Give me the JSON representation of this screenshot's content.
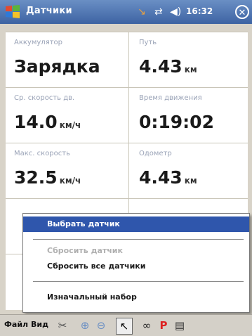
{
  "titlebar": {
    "title": "Датчики",
    "time": "16:32",
    "icons": [
      "start-menu-icon",
      "gps-signal-icon",
      "connectivity-icon",
      "volume-icon",
      "close-icon"
    ]
  },
  "sensors": [
    {
      "label": "Аккумулятор",
      "value": "Зарядка",
      "unit": ""
    },
    {
      "label": "Путь",
      "value": "4.43",
      "unit": "км"
    },
    {
      "label": "Ср. скорость дв.",
      "value": "14.0",
      "unit": "км/ч"
    },
    {
      "label": "Время движения",
      "value": "0:19:02",
      "unit": ""
    },
    {
      "label": "Макс. скорость",
      "value": "32.5",
      "unit": "км/ч"
    },
    {
      "label": "Одометр",
      "value": "4.43",
      "unit": "км"
    }
  ],
  "menu": {
    "items": [
      {
        "label": "Выбрать датчик",
        "state": "selected"
      },
      {
        "label": "Сбросить датчик",
        "state": "disabled"
      },
      {
        "label": "Сбросить все датчики",
        "state": "enabled"
      },
      {
        "label": "Изначальный набор",
        "state": "enabled"
      }
    ]
  },
  "toolbar": {
    "file_label": "Файл",
    "view_label": "Вид",
    "icons": [
      "tools-icon",
      "zoom-in-icon",
      "zoom-out-icon",
      "cursor-icon",
      "glasses-icon",
      "parking-icon",
      "keyboard-icon"
    ]
  },
  "colors": {
    "titlebar": "#3d63a3",
    "selection": "#2f56ac",
    "label": "#9aa3b7"
  }
}
